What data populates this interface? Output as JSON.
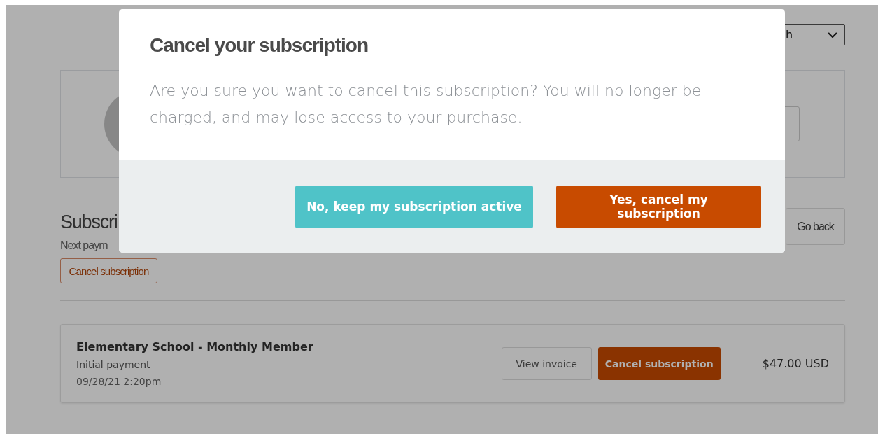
{
  "page": {
    "select": {
      "value": "h"
    },
    "heading": "Subscri",
    "next_payment": "Next paym",
    "cancel_button": "Cancel subscription",
    "back_button": "Go back",
    "rows": [
      {
        "title": "Elementary School - Monthly Member",
        "subtitle": "Initial payment",
        "date": "09/28/21 2:20pm",
        "invoice_button": "View invoice",
        "cancel_button": "Cancel subscription",
        "amount": "$47.00 USD"
      }
    ]
  },
  "modal": {
    "title": "Cancel your subscription",
    "message": "Are you sure you want to cancel this subscription? You will no longer be charged, and may lose access to your purchase.",
    "buttons": [
      {
        "label": "No, keep my subscription active",
        "kind": "secondary"
      },
      {
        "label": "Yes, cancel my subscription",
        "kind": "primary"
      }
    ]
  }
}
